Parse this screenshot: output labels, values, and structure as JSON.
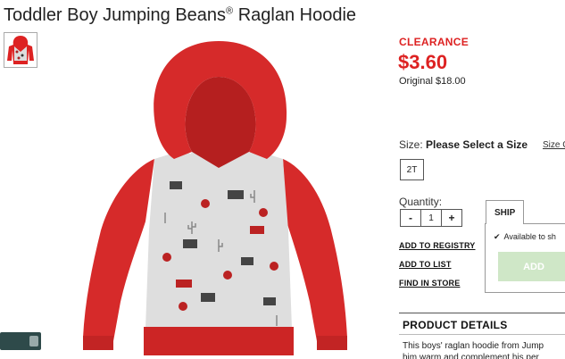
{
  "product": {
    "title": "Toddler Boy Jumping Beans",
    "trademark": "®",
    "title_suffix": "Raglan Hoodie"
  },
  "thumbnail": {
    "icon": "hoodie-thumbnail"
  },
  "pricing": {
    "badge": "CLEARANCE",
    "price": "$3.60",
    "original": "Original $18.00",
    "accent_color": "#dd2222"
  },
  "size": {
    "label": "Size:",
    "prompt": "Please Select a Size",
    "chart_link": "Size C",
    "options": [
      "2T"
    ]
  },
  "quantity": {
    "label": "Quantity:",
    "minus": "-",
    "value": "1",
    "plus": "+"
  },
  "links": {
    "registry": "ADD TO REGISTRY",
    "list": "ADD TO LIST",
    "store": "FIND IN STORE"
  },
  "fulfillment": {
    "tab": "SHIP",
    "check_icon": "✔",
    "availability": "Available to sh",
    "add_button": "ADD"
  },
  "details": {
    "heading": "PRODUCT DETAILS",
    "line1": "This boys' raglan hoodie from Jump",
    "line2": "him warm and complement his per"
  }
}
